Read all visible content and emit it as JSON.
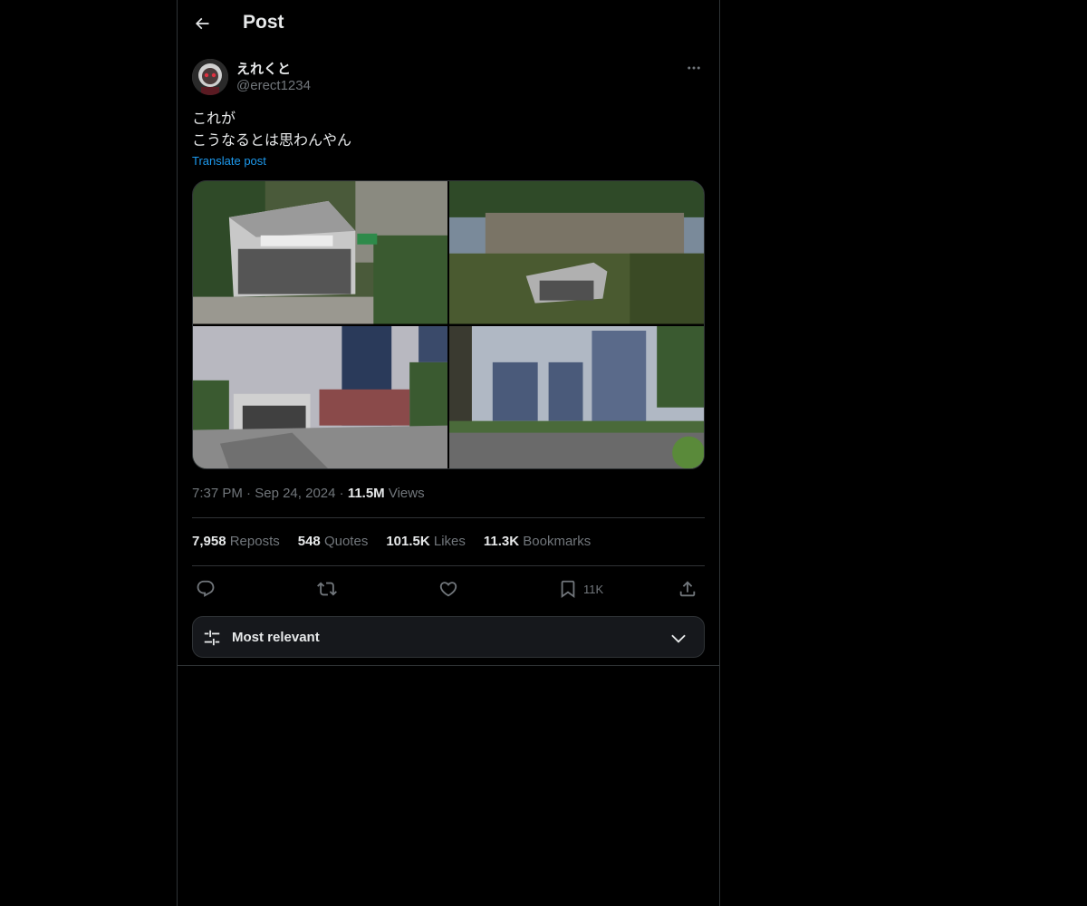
{
  "header": {
    "title": "Post",
    "back_icon": "arrow-left-icon"
  },
  "author": {
    "display_name": "えれくと",
    "handle": "@erect1234",
    "more_icon": "more-horizontal-icon"
  },
  "post": {
    "text_line1": "これが",
    "text_line2": "こうなるとは思わんやん",
    "translate_label": "Translate post",
    "media_count": 4
  },
  "meta": {
    "time": "7:37 PM",
    "date": "Sep 24, 2024",
    "views_count": "11.5M",
    "views_label": "Views"
  },
  "stats": {
    "reposts_count": "7,958",
    "reposts_label": "Reposts",
    "quotes_count": "548",
    "quotes_label": "Quotes",
    "likes_count": "101.5K",
    "likes_label": "Likes",
    "bookmarks_count": "11.3K",
    "bookmarks_label": "Bookmarks"
  },
  "actions": {
    "reply_icon": "reply-icon",
    "repost_icon": "repost-icon",
    "like_icon": "heart-icon",
    "bookmark_icon": "bookmark-icon",
    "bookmark_count": "11K",
    "share_icon": "share-icon"
  },
  "replies_sort": {
    "label": "Most relevant",
    "icon": "sliders-icon",
    "chevron": "chevron-down-icon"
  },
  "colors": {
    "background": "#000000",
    "text_primary": "#e7e9ea",
    "text_secondary": "#71767b",
    "accent": "#1d9bf0",
    "border": "#2f3336"
  }
}
